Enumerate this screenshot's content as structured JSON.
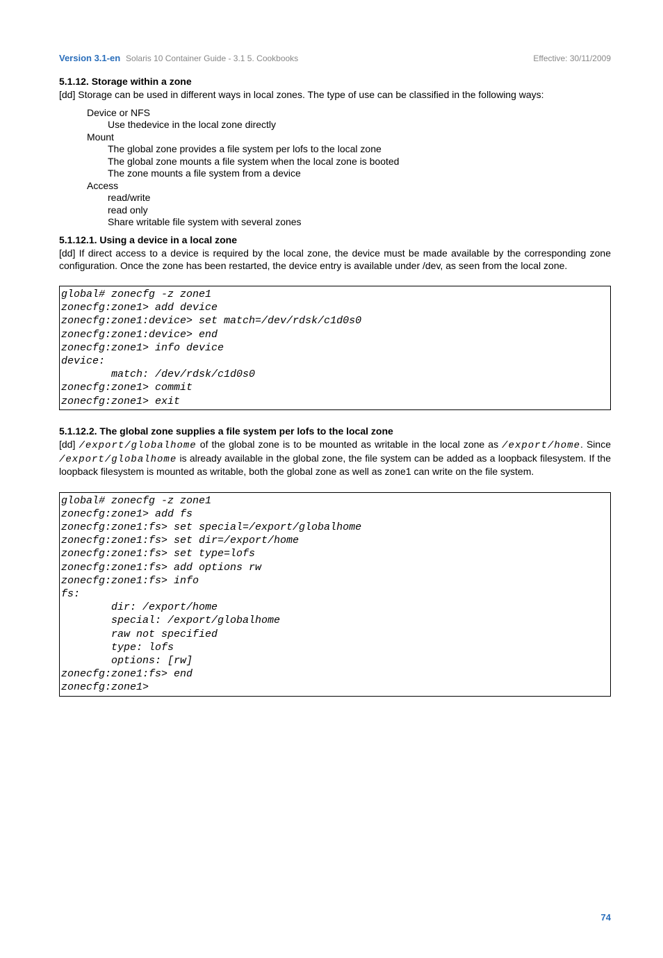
{
  "header": {
    "version_label": "Version 3.1-en",
    "doc_title": "Solaris 10 Container Guide - 3.1   5. Cookbooks",
    "effective": "Effective: 30/11/2009"
  },
  "section_5_1_12": {
    "heading": "5.1.12. Storage within a zone",
    "intro": "[dd] Storage can be used in different ways in local zones. The type of use can be classified in the following ways:",
    "defs": {
      "device_term": "Device or NFS",
      "device_items": [
        "Use thedevice in the local zone directly"
      ],
      "mount_term": "Mount",
      "mount_items": [
        "The global zone provides a file system per lofs to the local zone",
        "The global zone mounts a file system when the local zone is booted",
        "The zone mounts a file system from a  device"
      ],
      "access_term": "Access",
      "access_items": [
        "read/write",
        "read only",
        "Share writable file system with several zones"
      ]
    }
  },
  "section_5_1_12_1": {
    "heading": "5.1.12.1. Using a device in a local zone",
    "intro": "[dd] If direct access to a device is required by the local zone, the device must be made available by the corresponding zone configuration. Once the zone has been restarted, the device entry is available under /dev, as seen from the local zone.",
    "code": "global# zonecfg -z zone1 \nzonecfg:zone1> add device\nzonecfg:zone1:device> set match=/dev/rdsk/c1d0s0\nzonecfg:zone1:device> end\nzonecfg:zone1> info device\ndevice: \n        match: /dev/rdsk/c1d0s0 \nzonecfg:zone1> commit \nzonecfg:zone1> exit "
  },
  "section_5_1_12_2": {
    "heading": "5.1.12.2. The global zone supplies a file system per lofs to the local zone",
    "intro_parts": {
      "p1": "[dd] ",
      "code1": "/export/globalhome",
      "p2": " of the global zone is to be mounted as writable in the local zone as ",
      "code2": "/export/home",
      "p3": ". Since ",
      "code3": "/export/globalhome",
      "p4": " is already available in the global zone, the file system can be added as a loopback filesystem. If the loopback filesystem is mounted as writable, both the global zone as well as zone1 can write on the file system."
    },
    "code": "global# zonecfg -z zone1 \nzonecfg:zone1> add fs\nzonecfg:zone1:fs> set special=/export/globalhome\nzonecfg:zone1:fs> set dir=/export/home \nzonecfg:zone1:fs> set type=lofs\nzonecfg:zone1:fs> add options rw\nzonecfg:zone1:fs> info\nfs: \n        dir: /export/home \n        special: /export/globalhome \n        raw not specified \n        type: lofs \n        options: [rw] \nzonecfg:zone1:fs> end \nzonecfg:zone1> "
  },
  "footer": {
    "page_number": "74"
  }
}
